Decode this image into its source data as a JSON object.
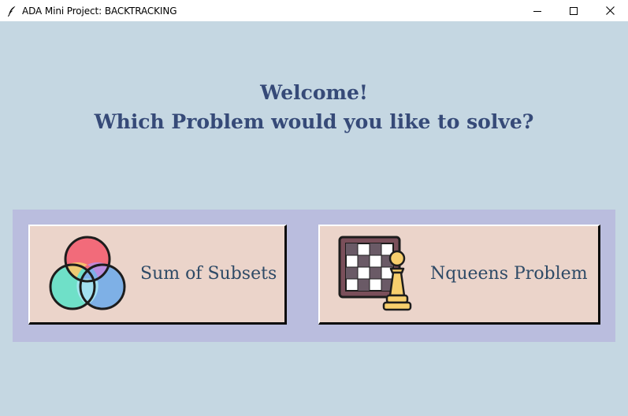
{
  "window": {
    "title": "ADA Mini Project: BACKTRACKING",
    "app_icon": "feather-icon",
    "controls": [
      "minimize-icon",
      "maximize-icon",
      "close-icon"
    ]
  },
  "heading": {
    "line1": "Welcome!",
    "line2": "Which Problem would you like to solve?",
    "color": "#364a78"
  },
  "options": [
    {
      "label": "Sum of Subsets",
      "icon": "venn-diagram-icon"
    },
    {
      "label": "Nqueens Problem",
      "icon": "chessboard-pawn-icon"
    }
  ],
  "colors": {
    "background": "#c5d7e2",
    "panel": "#babdde",
    "button": "#ebd4ca",
    "button_text": "#2e4a66"
  }
}
